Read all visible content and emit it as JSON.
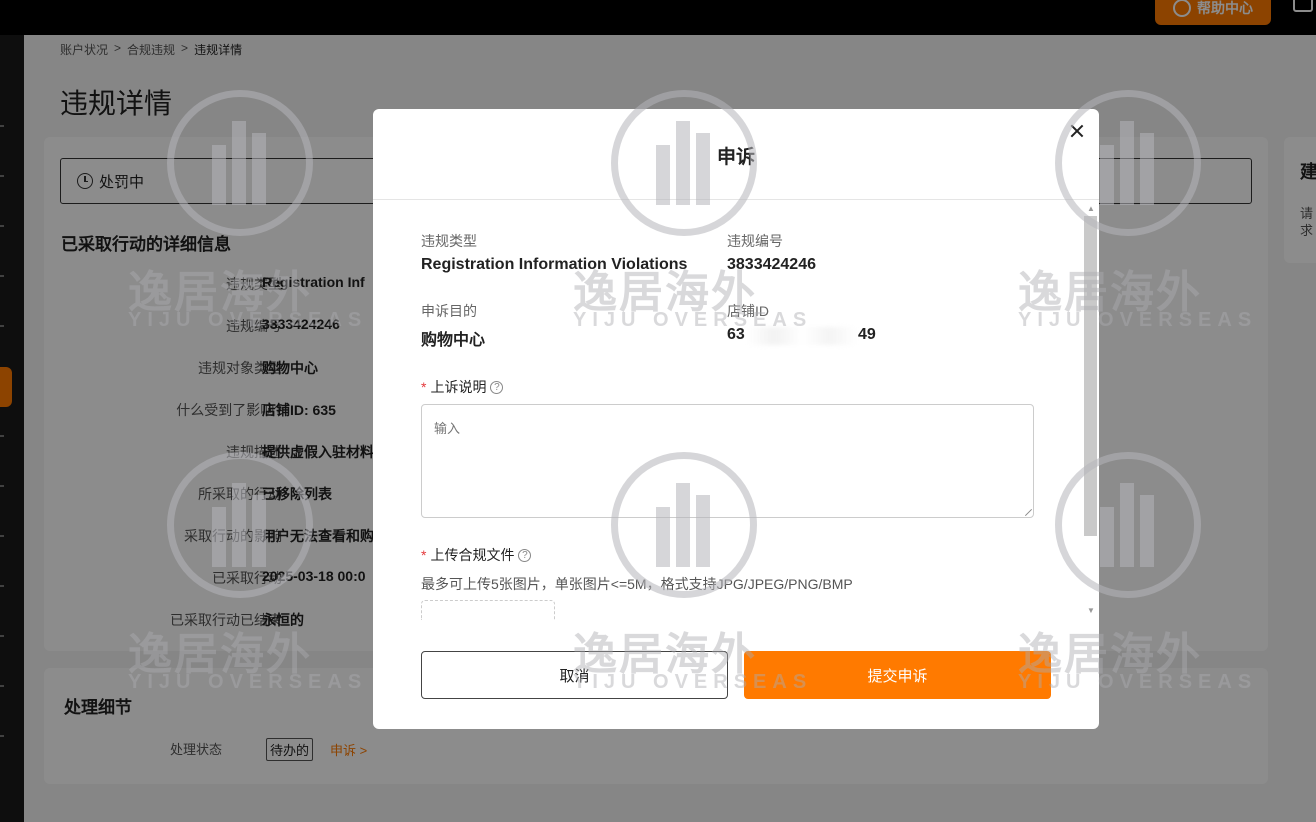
{
  "header": {
    "help_label": "帮助中心"
  },
  "breadcrumb": [
    "账户状况",
    "合规违规",
    "违规详情"
  ],
  "breadcrumb_sep": ">",
  "page_title": "违规详情",
  "status": {
    "label": "处罚中"
  },
  "details": {
    "title": "已采取行动的详细信息",
    "rows": [
      {
        "label": "违规类型",
        "value": "Registration Inf"
      },
      {
        "label": "违规编号",
        "value": "3833424246"
      },
      {
        "label": "违规对象类型",
        "value": "购物中心"
      },
      {
        "label": "什么受到了影响?",
        "value": "店铺ID: 635"
      },
      {
        "label": "违规描述",
        "value": "提供虚假入驻材料"
      },
      {
        "label": "所采取的行动",
        "value": "已移除列表"
      },
      {
        "label": "采取行动的影响",
        "value": "用户无法查看和购"
      },
      {
        "label": "已采取行动",
        "value": "2025-03-18 00:0"
      },
      {
        "label": "已采取行动已结束",
        "value": "永恒的"
      }
    ]
  },
  "right_card": {
    "title": "建",
    "text": "请求"
  },
  "processing": {
    "title": "处理细节",
    "status_label": "处理状态",
    "status_value": "待办的",
    "appeal_link": "申诉 >"
  },
  "watermark": {
    "text": "逸居海外",
    "sub": "YIJU OVERSEAS"
  },
  "modal": {
    "title": "申诉",
    "fields": {
      "violation_type_label": "违规类型",
      "violation_type_value": "Registration Information Violations",
      "violation_id_label": "违规编号",
      "violation_id_value": "3833424246",
      "purpose_label": "申诉目的",
      "purpose_value": "购物中心",
      "store_id_label": "店铺ID",
      "store_id_prefix": "63",
      "store_id_suffix": "49"
    },
    "explanation": {
      "required": "*",
      "label": "上诉说明",
      "placeholder": "输入"
    },
    "upload": {
      "required": "*",
      "label": "上传合规文件",
      "hint": "最多可上传5张图片，单张图片<=5M，格式支持JPG/JPEG/PNG/BMP"
    },
    "cancel_label": "取消",
    "submit_label": "提交申诉"
  },
  "colors": {
    "accent": "#ff7a00",
    "required": "#e4393c"
  }
}
